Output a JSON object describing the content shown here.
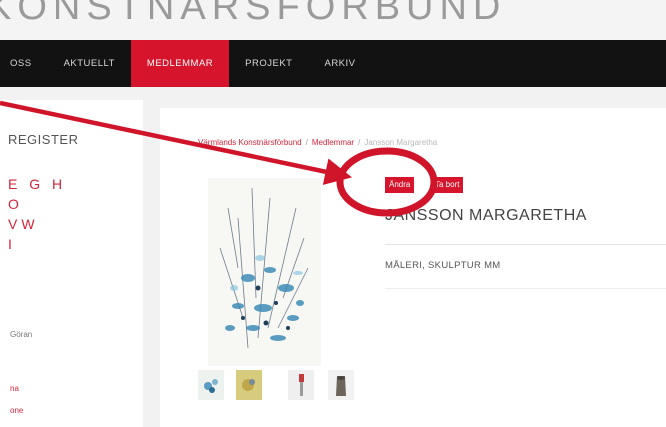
{
  "header": {
    "logo_text": "KONSTNÄRSFÖRBUND"
  },
  "nav": {
    "items": [
      {
        "label": "OSS",
        "active": false
      },
      {
        "label": "AKTUELLT",
        "active": false
      },
      {
        "label": "MEDLEMMAR",
        "active": true
      },
      {
        "label": "PROJEKT",
        "active": false
      },
      {
        "label": "ARKIV",
        "active": false
      }
    ]
  },
  "sidebar": {
    "title": "REGISTER",
    "alphabet_lines": [
      "E G H",
      "O",
      "VW",
      "I"
    ],
    "links": [
      "Göran",
      "na",
      "one"
    ]
  },
  "breadcrumb": {
    "items": [
      "Värmlands Konstnärsförbund",
      "Medlemmar"
    ],
    "separator": "/",
    "current": "Jansson Margaretha"
  },
  "profile": {
    "edit_label": "Ändra",
    "delete_label": "Ta bort",
    "name": "JANSSON MARGARETHA",
    "category": "MÅLERI, SKULPTUR MM"
  },
  "colors": {
    "accent": "#d6152c",
    "nav_bg": "#121212",
    "annotation": "#d0142a"
  },
  "thumbnails": [
    {
      "name": "thumb-blue-flowers"
    },
    {
      "name": "thumb-yellow-painting"
    },
    {
      "name": "thumb-figure-red"
    },
    {
      "name": "thumb-sculpture-vase"
    }
  ]
}
